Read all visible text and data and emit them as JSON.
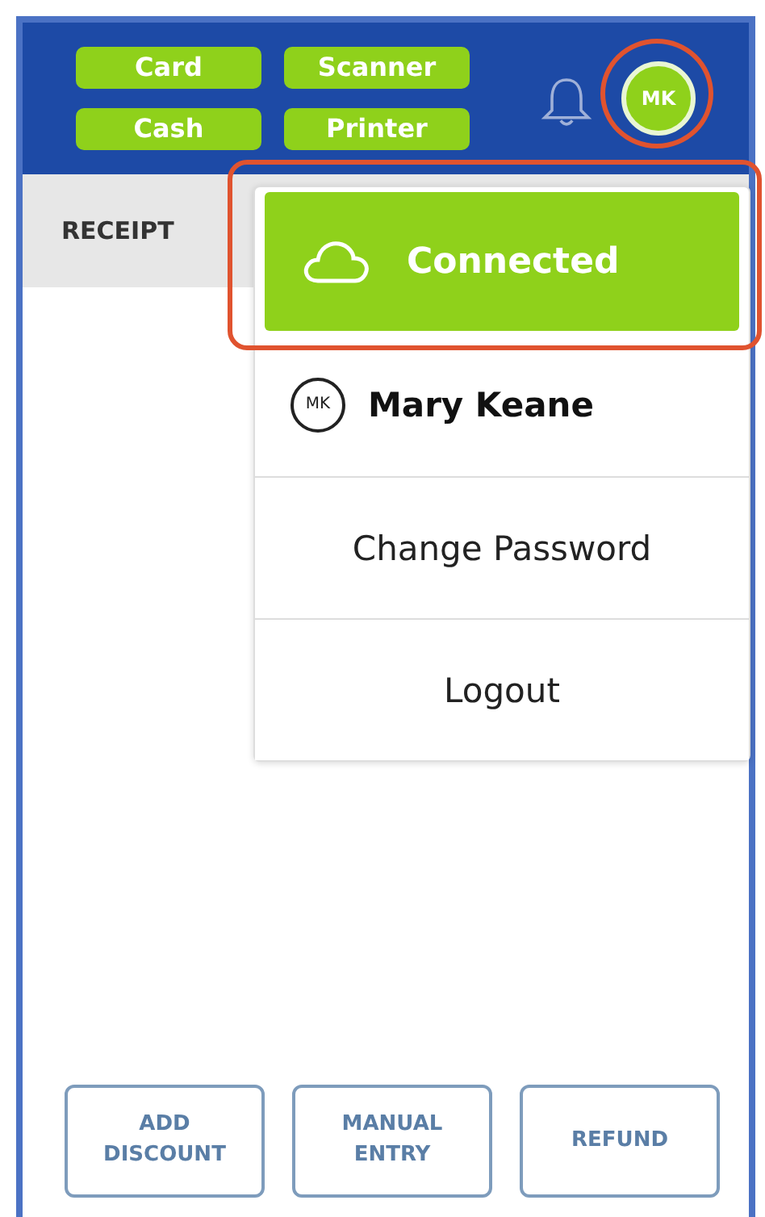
{
  "header": {
    "status_chips": [
      {
        "label": "Card"
      },
      {
        "label": "Scanner"
      },
      {
        "label": "Cash"
      },
      {
        "label": "Printer"
      }
    ],
    "avatar": {
      "initials": "MK",
      "highlighted": true
    }
  },
  "tabs": [
    {
      "label": "RECEIPT",
      "selected": true
    }
  ],
  "user_menu": {
    "status": {
      "label": "Connected",
      "highlighted": true
    },
    "user": {
      "initials": "MK",
      "name": "Mary Keane"
    },
    "items": [
      {
        "label": "Change Password"
      },
      {
        "label": "Logout"
      }
    ]
  },
  "actions": [
    {
      "lines": [
        "ADD",
        "DISCOUNT"
      ]
    },
    {
      "lines": [
        "MANUAL",
        "ENTRY"
      ]
    },
    {
      "lines": [
        "REFUND"
      ]
    }
  ]
}
